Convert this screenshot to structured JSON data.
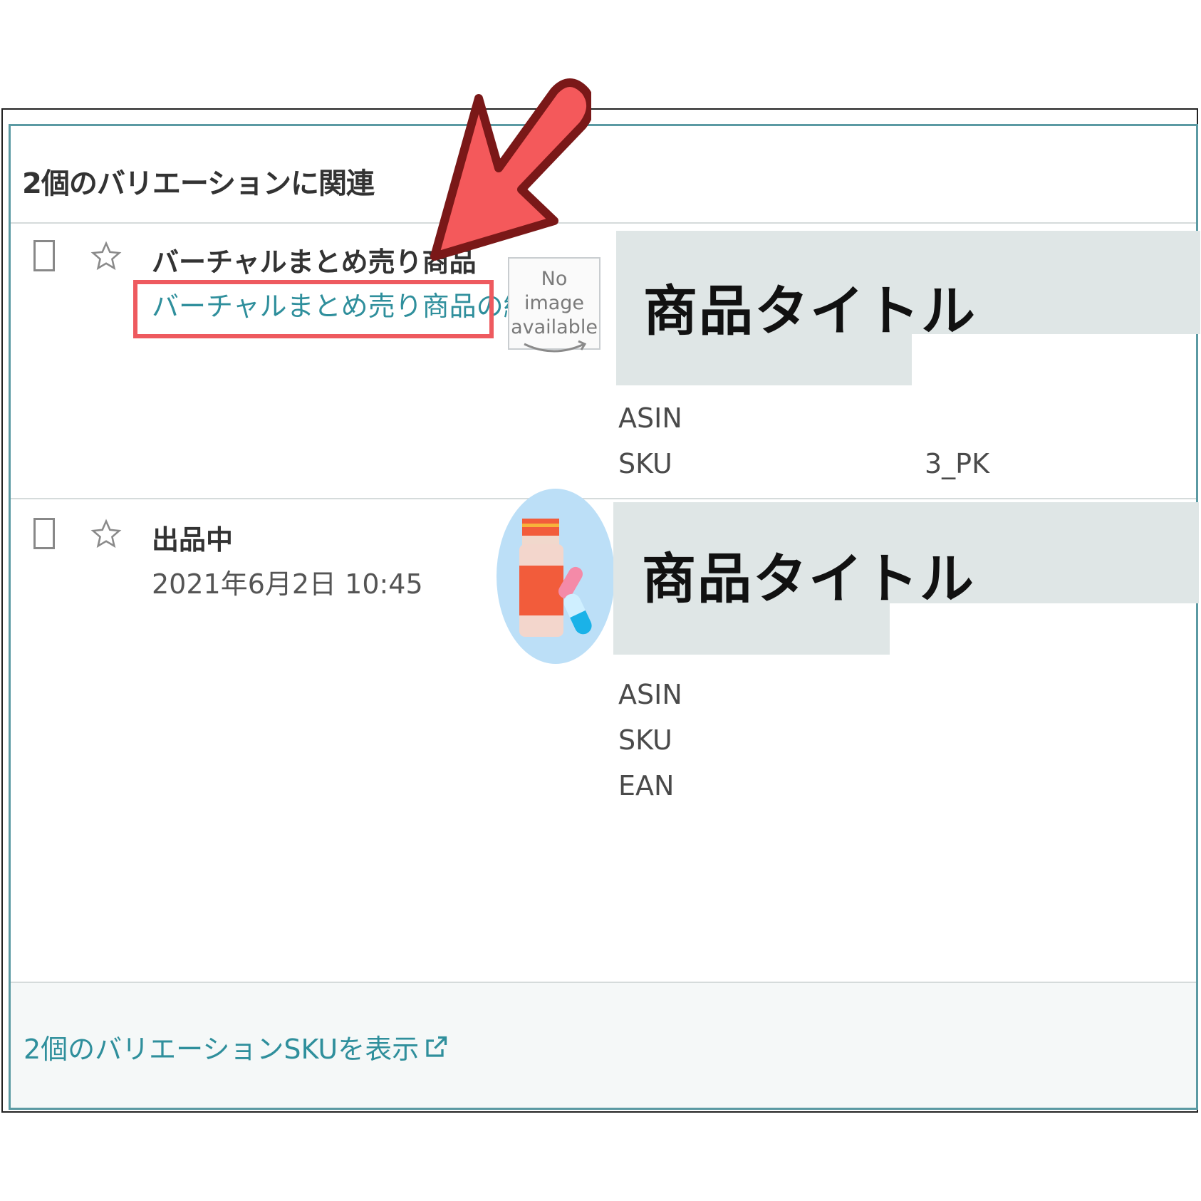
{
  "header": {
    "title": "2個のバリエーションに関連"
  },
  "rows": [
    {
      "name": "バーチャルまとめ売り商品",
      "edit_link": "バーチャルまとめ売り商品の編集",
      "image": {
        "line1": "No image",
        "line2": "available"
      },
      "title_overlay": "商品タイトル",
      "attributes": [
        {
          "label": "ASIN",
          "value": ""
        },
        {
          "label": "SKU",
          "value": "3_PK"
        }
      ]
    },
    {
      "status": "出品中",
      "date": "2021年6月2日 10:45",
      "title_overlay": "商品タイトル",
      "attributes": [
        {
          "label": "ASIN"
        },
        {
          "label": "SKU"
        },
        {
          "label": "EAN"
        }
      ]
    }
  ],
  "footer": {
    "link": "2個のバリエーションSKUを表示"
  },
  "colors": {
    "accent": "#2f8f9c",
    "annotation_red": "#ee5a5f",
    "mask": "#dfe6e6"
  }
}
